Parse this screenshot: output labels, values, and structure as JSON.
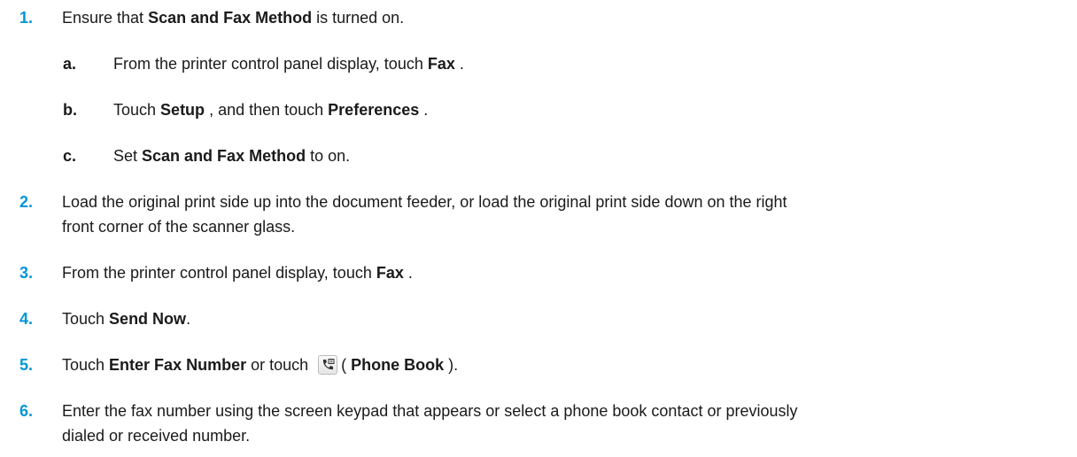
{
  "steps": [
    {
      "num": "1.",
      "t1": "Ensure that ",
      "b1": "Scan and Fax Method",
      "t2": " is turned on."
    },
    {
      "num": "2.",
      "line1": "Load the original print side up into the document feeder, or load the original print side down on the right",
      "line2": "front corner of the scanner glass."
    },
    {
      "num": "3.",
      "t1": "From the printer control panel display, touch ",
      "b1": "Fax",
      "t2": " ."
    },
    {
      "num": "4.",
      "t1": "Touch ",
      "b1": "Send Now",
      "t2": "."
    },
    {
      "num": "5.",
      "t1": "Touch ",
      "b1": "Enter Fax Number",
      "t2": " or touch ",
      "t3": "( ",
      "b2": "Phone Book",
      "t4": " )."
    },
    {
      "num": "6.",
      "line1": "Enter the fax number using the screen keypad that appears or select a phone book contact or previously",
      "line2": "dialed or received number."
    }
  ],
  "substeps": [
    {
      "letter": "a.",
      "t1": "From the printer control panel display, touch ",
      "b1": "Fax",
      "t2": " ."
    },
    {
      "letter": "b.",
      "t1": "Touch ",
      "b1": "Setup",
      "t2": " , and then touch ",
      "b2": "Preferences",
      "t3": " ."
    },
    {
      "letter": "c.",
      "t1": "Set ",
      "b1": "Scan and Fax Method",
      "t2": " to on."
    }
  ],
  "icons": {
    "phone_book": "phone-book-icon"
  },
  "colors": {
    "step_number": "#0096d6",
    "text": "#1a1a1a"
  }
}
